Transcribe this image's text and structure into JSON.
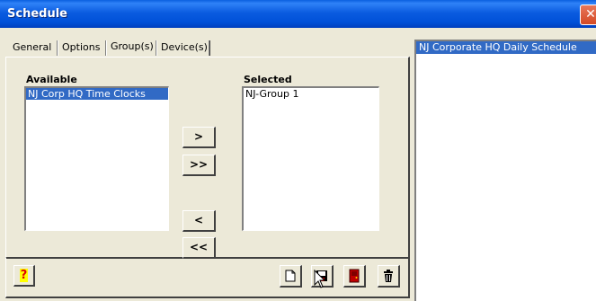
{
  "window": {
    "title": "Schedule",
    "close_label": "✕"
  },
  "tabs": [
    "General",
    "Options",
    "Group(s)",
    "Device(s)"
  ],
  "available": {
    "label": "Available",
    "items": [
      "NJ Corp HQ Time Clocks"
    ]
  },
  "selected": {
    "label": "Selected",
    "items": [
      "NJ-Group 1"
    ]
  },
  "transfer_buttons": {
    "add": ">",
    "add_all": ">>",
    "remove": "<",
    "remove_all": "<<"
  },
  "toolbar": {
    "help_label": "?"
  },
  "schedules": {
    "items": [
      "NJ Corporate HQ Daily Schedule"
    ]
  },
  "colors": {
    "titlebar": "#0a5fe0",
    "selection": "#316ac5",
    "face": "#ece9d8"
  },
  "icons": [
    "help-icon",
    "new-document-icon",
    "save-icon",
    "exit-door-icon",
    "trash-icon",
    "mouse-cursor-icon"
  ]
}
